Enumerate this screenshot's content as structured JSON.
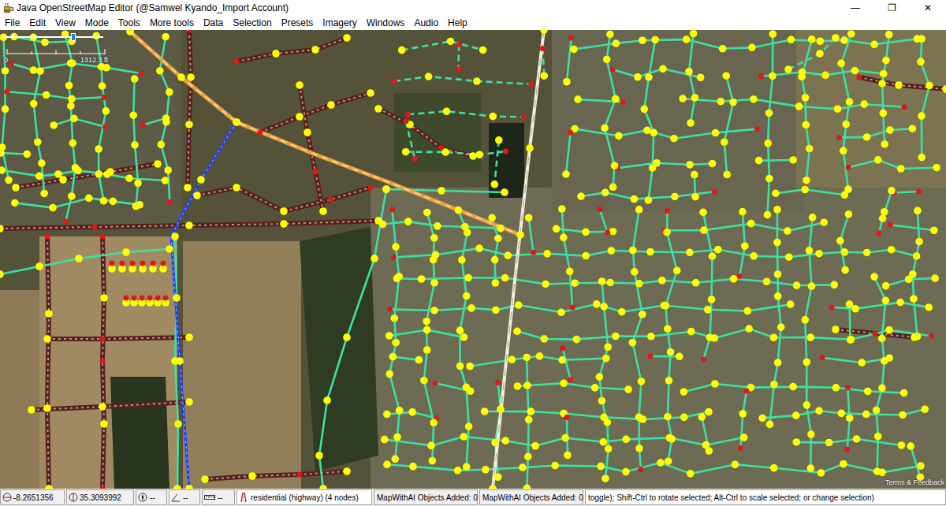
{
  "window": {
    "title": "Java OpenStreetMap Editor (@Samwel Kyando_Import Account)",
    "controls": [
      "—",
      "❐",
      "✕"
    ]
  },
  "menu": [
    {
      "label": "File"
    },
    {
      "label": "Edit"
    },
    {
      "label": "View"
    },
    {
      "label": "Mode"
    },
    {
      "label": "Tools"
    },
    {
      "label": "More tools"
    },
    {
      "label": "Data"
    },
    {
      "label": "Selection"
    },
    {
      "label": "Presets"
    },
    {
      "label": "Imagery"
    },
    {
      "label": "Windows"
    },
    {
      "label": "Audio"
    },
    {
      "label": "Help"
    }
  ],
  "scale": {
    "level": 0.7,
    "zero": "0",
    "distance": "1312.3 ft"
  },
  "map": {
    "attribution": "Terms & Feedback"
  },
  "status_bar": {
    "latitude": "-8.2651356",
    "longitude": "35.3093992",
    "heading": "--",
    "angle": "--",
    "distance": "--",
    "selection": "residential (highway) (4 nodes)",
    "mapwithai": [
      "MapWithAI Objects Added: 0",
      "MapWithAI Objects Added: 0"
    ],
    "help": "toggle); Shift-Ctrl to rotate selected; Alt-Ctrl to scale selected; or change selection)"
  }
}
